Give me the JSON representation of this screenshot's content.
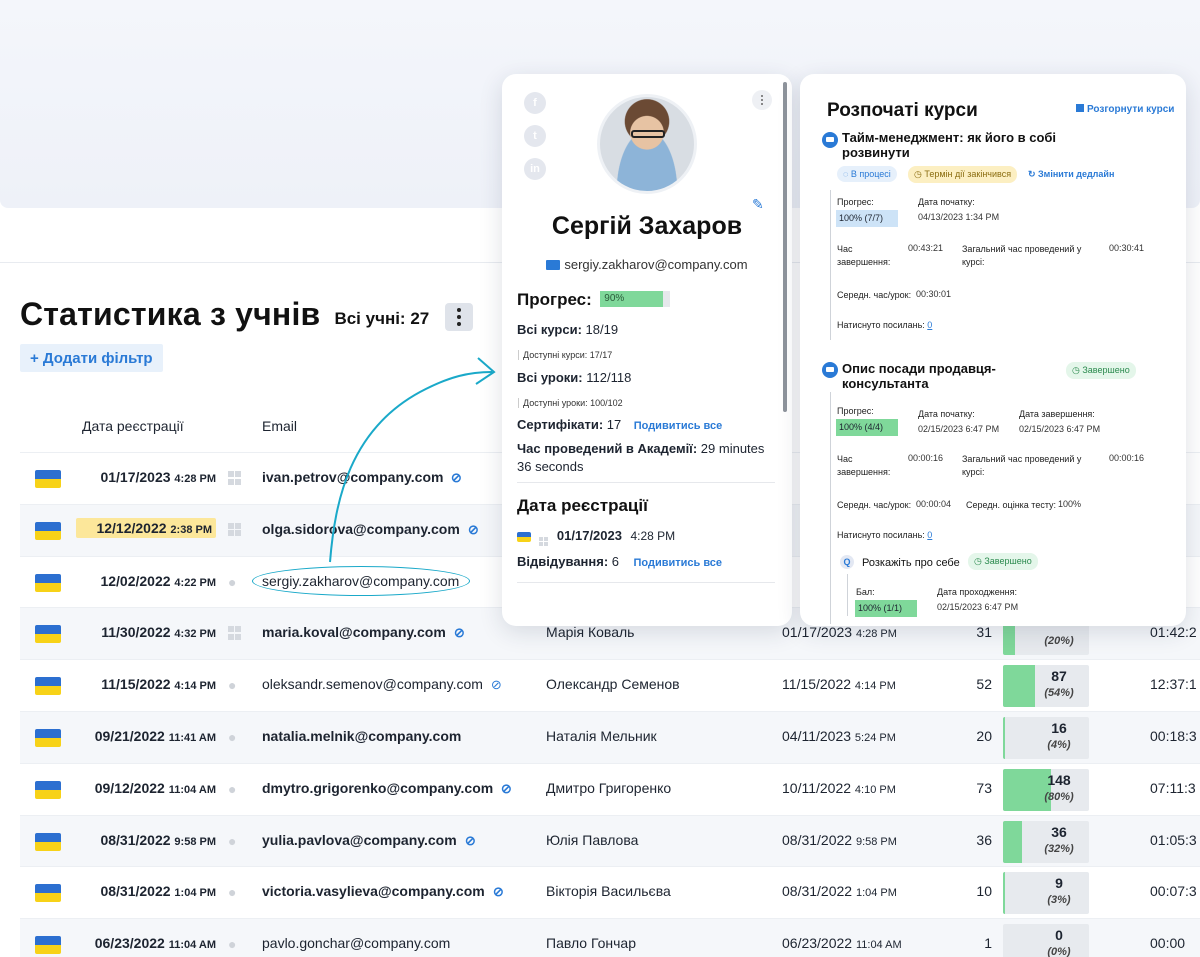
{
  "page": {
    "title": "Статистика з учнів",
    "all_students_label": "Всі учні: 27",
    "add_filter": "+ Додати фільтр"
  },
  "table": {
    "columns": {
      "reg_date": "Дата реєстрації",
      "email": "Email"
    },
    "rows": [
      {
        "date": "01/17/2023",
        "time": "4:28 PM",
        "os": "windows-icon",
        "email": "ivan.petrov@company.com",
        "name": "",
        "last_date": "",
        "last_time": "",
        "count": "",
        "progress_value": "",
        "progress_pct": "",
        "progress": 0,
        "duration": ""
      },
      {
        "date": "12/12/2022",
        "time": "2:38 PM",
        "os": "windows-icon",
        "email": "olga.sidorova@company.com",
        "name": "",
        "last_date": "",
        "last_time": "",
        "count": "",
        "progress_value": "",
        "progress_pct": "",
        "progress": 0,
        "duration": ""
      },
      {
        "date": "12/02/2022",
        "time": "4:22 PM",
        "os": "apple-icon",
        "email": "sergiy.zakharov@company.com",
        "name": "",
        "last_date": "",
        "last_time": "",
        "count": "",
        "progress_value": "",
        "progress_pct": "",
        "progress": 0,
        "duration": ""
      },
      {
        "date": "11/30/2022",
        "time": "4:32 PM",
        "os": "windows-icon",
        "email": "maria.koval@company.com",
        "name": "Марія Коваль",
        "last_date": "01/17/2023",
        "last_time": "4:28 PM",
        "count": "31",
        "progress_value": "",
        "progress_pct": "(20%)",
        "progress": 20,
        "duration": "01:42:2"
      },
      {
        "date": "11/15/2022",
        "time": "4:14 PM",
        "os": "apple-icon",
        "email": "oleksandr.semenov@company.com",
        "name": "Олександр Семенов",
        "last_date": "11/15/2022",
        "last_time": "4:14 PM",
        "count": "52",
        "progress_value": "87",
        "progress_pct": "(54%)",
        "progress": 54,
        "duration": "12:37:1"
      },
      {
        "date": "09/21/2022",
        "time": "11:41 AM",
        "os": "apple-icon",
        "email": "natalia.melnik@company.com",
        "name": "Наталія Мельник",
        "last_date": "04/11/2023",
        "last_time": "5:24 PM",
        "count": "20",
        "progress_value": "16",
        "progress_pct": "(4%)",
        "progress": 4,
        "duration": "00:18:3"
      },
      {
        "date": "09/12/2022",
        "time": "11:04 AM",
        "os": "apple-icon",
        "email": "dmytro.grigorenko@company.com",
        "name": "Дмитро Григоренко",
        "last_date": "10/11/2022",
        "last_time": "4:10 PM",
        "count": "73",
        "progress_value": "148",
        "progress_pct": "(80%)",
        "progress": 80,
        "duration": "07:11:3"
      },
      {
        "date": "08/31/2022",
        "time": "9:58 PM",
        "os": "apple-icon",
        "email": "yulia.pavlova@company.com",
        "name": "Юлія Павлова",
        "last_date": "08/31/2022",
        "last_time": "9:58 PM",
        "count": "36",
        "progress_value": "36",
        "progress_pct": "(32%)",
        "progress": 32,
        "duration": "01:05:3"
      },
      {
        "date": "08/31/2022",
        "time": "1:04 PM",
        "os": "apple-icon",
        "email": "victoria.vasylieva@company.com",
        "name": "Вікторія Васильєва",
        "last_date": "08/31/2022",
        "last_time": "1:04 PM",
        "count": "10",
        "progress_value": "9",
        "progress_pct": "(3%)",
        "progress": 3,
        "duration": "00:07:3"
      },
      {
        "date": "06/23/2022",
        "time": "11:04 AM",
        "os": "apple-icon",
        "email": "pavlo.gonchar@company.com",
        "name": "Павло Гончар",
        "last_date": "06/23/2022",
        "last_time": "11:04 AM",
        "count": "1",
        "progress_value": "0",
        "progress_pct": "(0%)",
        "progress": 0,
        "duration": "00:00"
      }
    ]
  },
  "profile": {
    "name": "Сергій Захаров",
    "email": "sergiy.zakharov@company.com",
    "progress_label": "Прогрес:",
    "progress_value": "90%",
    "progress": 90,
    "all_courses": "Всі курси:",
    "all_courses_val": "18/19",
    "available_courses": "Доступні курси: 17/17",
    "all_lessons": "Всі уроки:",
    "all_lessons_val": "112/118",
    "available_lessons": "Доступні уроки: 100/102",
    "certificates": "Сертифікати:",
    "certificates_val": "17",
    "view_all": "Подивитись все",
    "time_in_academy": "Час проведений в Академії:",
    "time_in_academy_val": "29 minutes 36 seconds",
    "reg_heading": "Дата реєстрації",
    "reg_date": "01/17/2023",
    "reg_time": "4:28 PM",
    "visits": "Відвідування:",
    "visits_val": "6",
    "social": [
      "f",
      "t",
      "in"
    ]
  },
  "courses": {
    "title": "Розпочаті курси",
    "expand": "Розгорнути курси",
    "c1": {
      "name": "Тайм-менеджмент: як його в собі розвинути",
      "badge_status": "В процесі",
      "badge_deadline": "Термін дії закінчився",
      "change_deadline": "Змінити дедлайн",
      "progress_lbl": "Прогрес:",
      "progress_val": "100% (7/7)",
      "start_lbl": "Дата початку:",
      "start_val": "04/13/2023 1:34 PM",
      "time_lbl": "Час завершення:",
      "time_val": "00:43:21",
      "total_lbl": "Загальний час проведений у курсі:",
      "total_val": "00:30:41",
      "avg_lbl": "Середн. час/урок:",
      "avg_val": "00:30:01",
      "clicks_lbl": "Натиснуто посилань:",
      "clicks_val": "0"
    },
    "c2": {
      "name": "Опис посади продавця-консультанта",
      "badge_status": "Завершено",
      "progress_lbl": "Прогрес:",
      "progress_val": "100% (4/4)",
      "start_lbl": "Дата початку:",
      "start_val": "02/15/2023 6:47 PM",
      "end_lbl": "Дата завершення:",
      "end_val": "02/15/2023 6:47 PM",
      "time_lbl": "Час завершення:",
      "time_val": "00:00:16",
      "total_lbl": "Загальний час проведений у курсі:",
      "total_val": "00:00:16",
      "avg_lbl": "Середн. час/урок:",
      "avg_val": "00:00:04",
      "test_lbl": "Середн. оцінка тесту:",
      "test_val": "100%",
      "clicks_lbl": "Натиснуто посилань:",
      "clicks_val": "0",
      "quiz_name": "Розкажіть про себе",
      "quiz_badge": "Завершено",
      "score_lbl": "Бал:",
      "score_val": "100% (1/1)",
      "pass_lbl": "Дата проходження:",
      "pass_val": "02/15/2023 6:47 PM"
    }
  },
  "colors": {
    "accent": "#2a7ad6",
    "progress": "#7fd89a",
    "highlight": "#fce79a",
    "annotation": "#1aa9c9"
  }
}
